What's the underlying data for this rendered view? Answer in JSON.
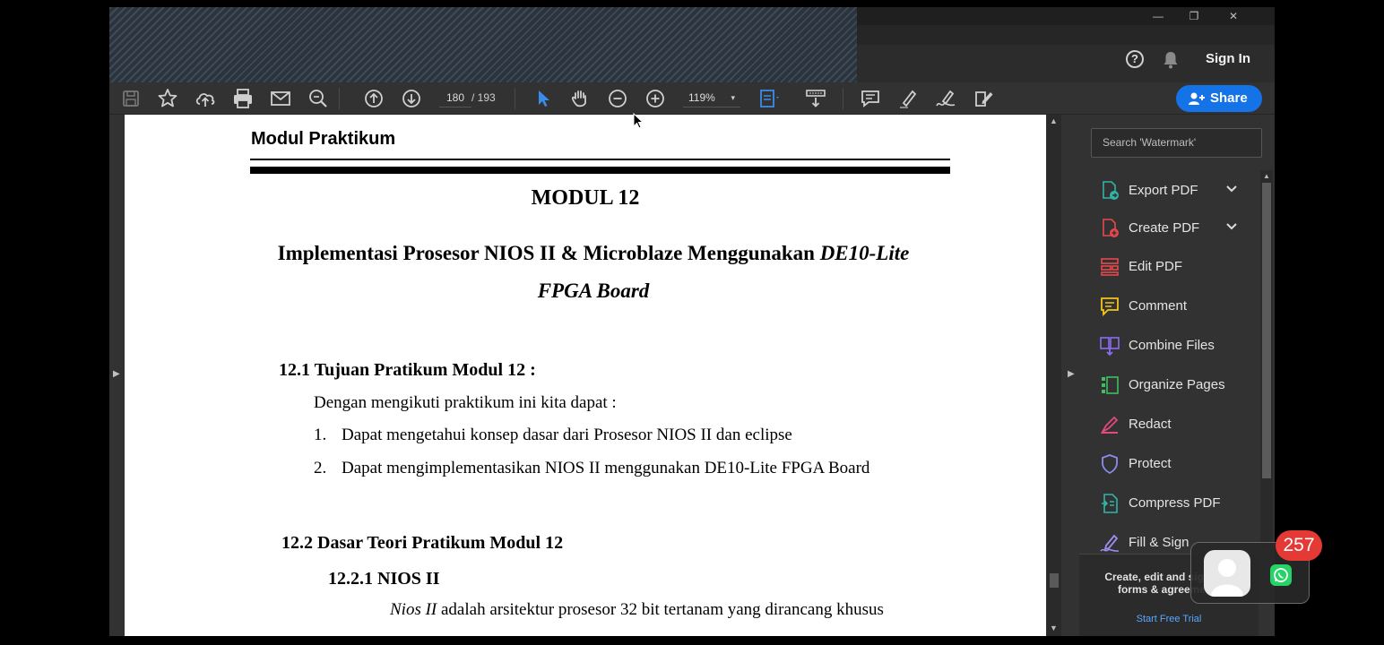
{
  "window": {
    "minimize_label": "—",
    "restore_label": "❐",
    "close_label": "✕"
  },
  "topbar": {
    "help_label": "?",
    "sign_in": "Sign In"
  },
  "toolbar": {
    "current_page": "180",
    "total_pages": "/ 193",
    "zoom": "119%",
    "zoom_caret": "▾",
    "share_label": "Share",
    "icons": [
      "save-icon",
      "bookmark-star-icon",
      "upload-cloud-icon",
      "print-icon",
      "email-icon",
      "find-icon",
      "page-up-icon",
      "page-down-icon",
      "select-cursor-icon",
      "hand-pan-icon",
      "zoom-out-icon",
      "zoom-in-icon",
      "fit-page-icon",
      "scroll-mode-icon",
      "comment-icon",
      "highlight-icon",
      "sign-icon",
      "edit-tools-icon"
    ]
  },
  "document": {
    "header": "Modul Praktikum",
    "module_title": "MODUL 12",
    "title_line1_plain": "Implementasi Prosesor NIOS II & Microblaze Menggunakan ",
    "title_line1_italic": "DE10-Lite",
    "title_line2": "FPGA Board",
    "section1_heading": "12.1 Tujuan Pratikum Modul  12 :",
    "section1_intro": "Dengan mengikuti praktikum ini kita dapat :",
    "objectives": [
      {
        "num": "1.",
        "text": "Dapat mengetahui konsep dasar dari Prosesor NIOS II dan eclipse"
      },
      {
        "num": "2.",
        "text": "Dapat mengimplementasikan NIOS II menggunakan DE10-Lite FPGA Board"
      }
    ],
    "section2_heading": "12.2  Dasar Teori Pratikum Modul 12",
    "subsection_heading": "12.2.1 NIOS II",
    "para_italic": "Nios II",
    "para_rest": " adalah arsitektur prosesor 32 bit tertanam yang dirancang khusus"
  },
  "right_pane": {
    "search_placeholder": "Search 'Watermark'",
    "tools": [
      {
        "label": "Export PDF",
        "icon": "export-pdf-icon",
        "expandable": true,
        "color": "#2fb5a8"
      },
      {
        "label": "Create PDF",
        "icon": "create-pdf-icon",
        "expandable": true,
        "color": "#e5484d"
      },
      {
        "label": "Edit PDF",
        "icon": "edit-pdf-icon",
        "expandable": false,
        "color": "#e5484d"
      },
      {
        "label": "Comment",
        "icon": "comment-icon",
        "expandable": false,
        "color": "#f5c518"
      },
      {
        "label": "Combine Files",
        "icon": "combine-files-icon",
        "expandable": false,
        "color": "#8c6cf0"
      },
      {
        "label": "Organize Pages",
        "icon": "organize-pages-icon",
        "expandable": false,
        "color": "#3fbf5f"
      },
      {
        "label": "Redact",
        "icon": "redact-icon",
        "expandable": false,
        "color": "#e5487d"
      },
      {
        "label": "Protect",
        "icon": "protect-icon",
        "expandable": false,
        "color": "#8c8cf0"
      },
      {
        "label": "Compress PDF",
        "icon": "compress-pdf-icon",
        "expandable": false,
        "color": "#2fb5a8"
      },
      {
        "label": "Fill & Sign",
        "icon": "fill-sign-icon",
        "expandable": false,
        "color": "#a08cf0"
      }
    ],
    "promo_text": "Create, edit and sign PDF forms & agreements",
    "promo_link": "Start Free Trial"
  },
  "notification": {
    "count": "257",
    "app_icon": "whatsapp-icon"
  },
  "colors": {
    "accent": "#1473e6",
    "badge": "#e53935"
  }
}
